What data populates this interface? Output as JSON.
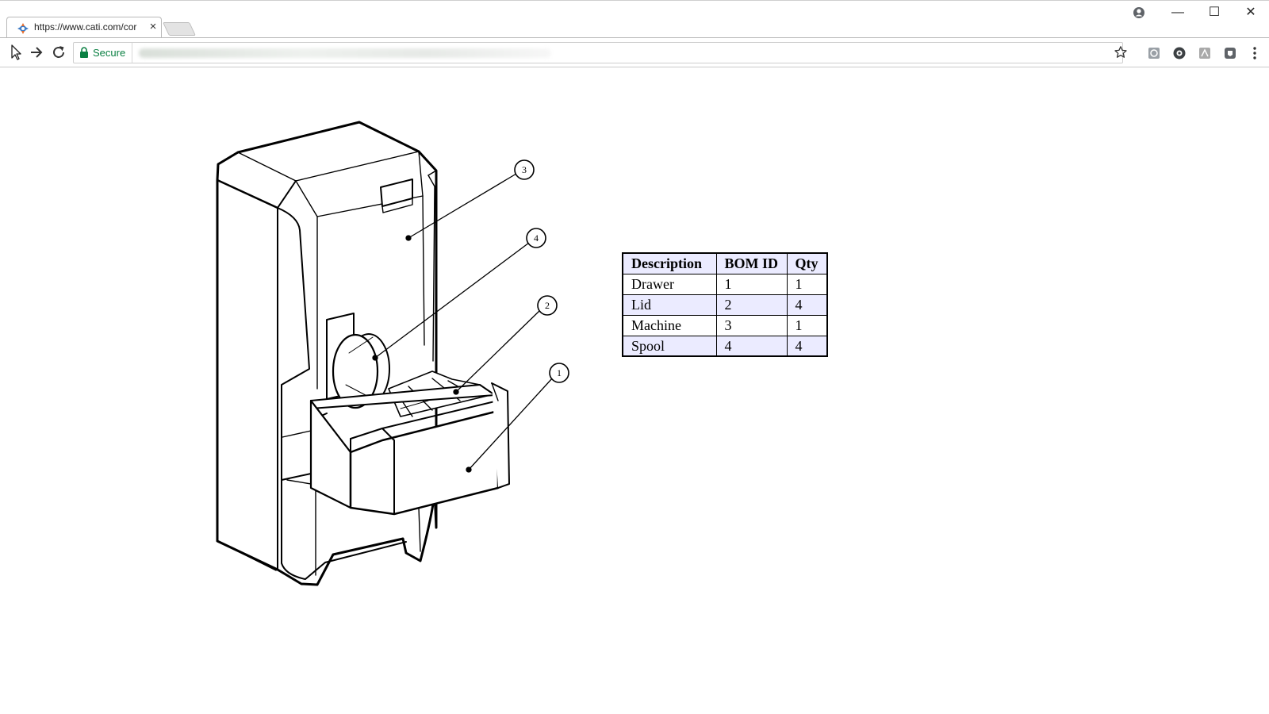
{
  "browser": {
    "tab_title": "https://www.cati.com/cor",
    "tab_close": "×",
    "secure_label": "Secure",
    "window_controls": {
      "minimize": "—",
      "maximize": "☐",
      "close": "✕"
    },
    "icons": [
      "cursor-icon",
      "forward-icon",
      "reload-icon",
      "lock-icon",
      "star-icon",
      "profile-icon",
      "menu-icon"
    ]
  },
  "callouts": [
    {
      "label": "3",
      "part": "Machine"
    },
    {
      "label": "4",
      "part": "Spool"
    },
    {
      "label": "2",
      "part": "Lid"
    },
    {
      "label": "1",
      "part": "Drawer"
    }
  ],
  "bom": {
    "headers": [
      "Description",
      "BOM ID",
      "Qty"
    ],
    "rows": [
      {
        "description": "Drawer",
        "bom_id": "1",
        "qty": "1"
      },
      {
        "description": "Lid",
        "bom_id": "2",
        "qty": "4"
      },
      {
        "description": "Machine",
        "bom_id": "3",
        "qty": "1"
      },
      {
        "description": "Spool",
        "bom_id": "4",
        "qty": "4"
      }
    ]
  },
  "colors": {
    "secure_green": "#0b8043",
    "table_header_bg": "#ebebff",
    "line": "#000000"
  }
}
